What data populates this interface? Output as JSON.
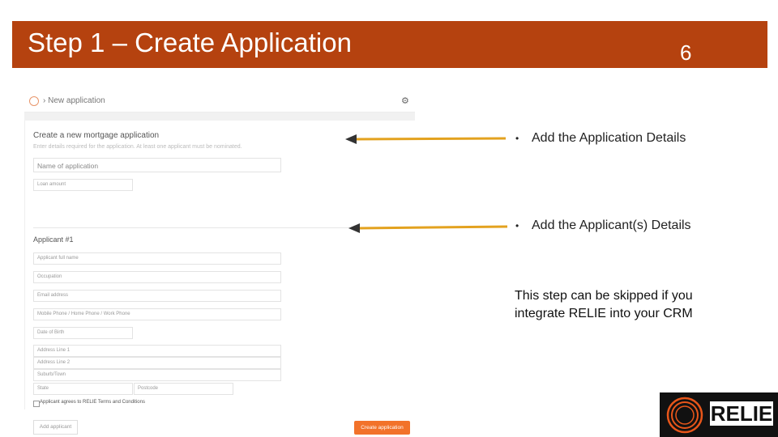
{
  "slide": {
    "title": "Step 1 – Create Application",
    "number": "6"
  },
  "colors": {
    "banner": "#b5420f",
    "arrow": "#e3a21f",
    "create_button": "#f2722a"
  },
  "app": {
    "breadcrumb": "New application",
    "settings_icon": "gear-icon",
    "form_title": "Create a new mortgage application",
    "form_subtitle": "Enter details required for the application. At least one applicant must be nominated.",
    "fields": {
      "application_name": "Name of application",
      "loan_amount": "Loan amount"
    },
    "applicant_heading": "Applicant #1",
    "applicant_fields": {
      "full_name": "Applicant full name",
      "occupation": "Occupation",
      "email": "Email address",
      "phone": "Mobile Phone / Home Phone / Work Phone",
      "dob": "Date of Birth",
      "address1": "Address Line 1",
      "address2": "Address Line 2",
      "suburb": "Suburb/Town",
      "state": "State",
      "postcode": "Postcode"
    },
    "terms_label": "Applicant agrees to RELIE Terms and Conditions",
    "add_applicant": "Add applicant",
    "create_application": "Create application"
  },
  "bullets": {
    "bullet_char": "•",
    "item1": "Add the Application Details",
    "item2": "Add the Applicant(s) Details"
  },
  "note": {
    "line1": "This step can be skipped if you",
    "line2": "integrate RELIE into your CRM"
  },
  "logo": {
    "text": "RELIE"
  }
}
